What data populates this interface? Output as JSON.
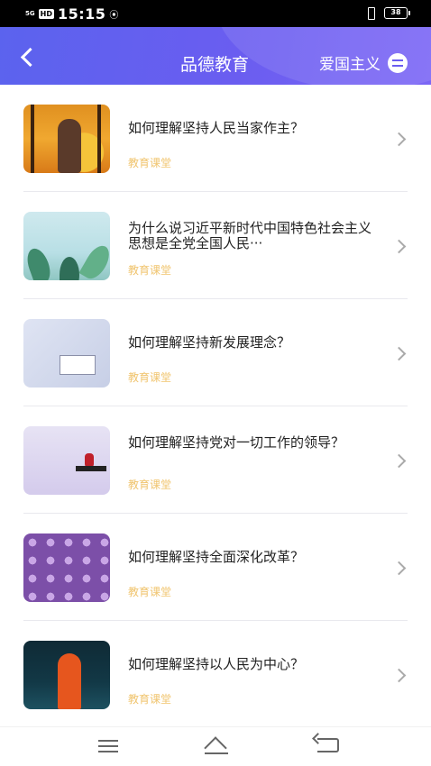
{
  "status_bar": {
    "network": "5G",
    "hd": "HD",
    "time": "15:15",
    "battery": "38"
  },
  "header": {
    "title": "品德教育",
    "switch_label": "爱国主义"
  },
  "items": [
    {
      "title": "如何理解坚持人民当家作主？",
      "tag": "教育课堂"
    },
    {
      "title": "为什么说习近平新时代中国特色社会主义思想是全党全国人民···",
      "tag": "教育课堂"
    },
    {
      "title": "如何理解坚持新发展理念？",
      "tag": "教育课堂"
    },
    {
      "title": "如何理解坚持党对一切工作的领导？",
      "tag": "教育课堂"
    },
    {
      "title": "如何理解坚持全面深化改革？",
      "tag": "教育课堂"
    },
    {
      "title": "如何理解坚持以人民为中心？",
      "tag": "教育课堂"
    }
  ],
  "colors": {
    "header_gradient_start": "#5b63ee",
    "header_gradient_end": "#7b66f5",
    "tag": "#f0c46e"
  }
}
